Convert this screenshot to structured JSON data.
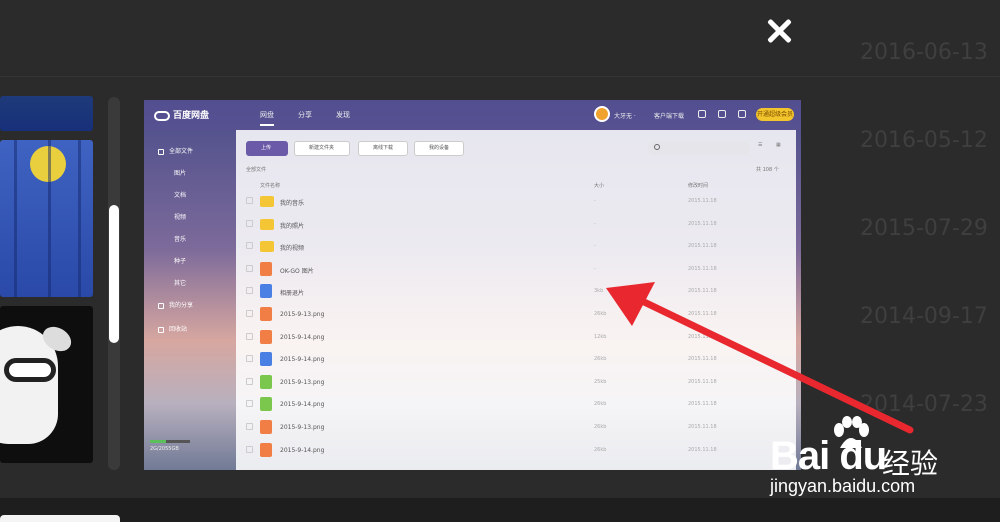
{
  "background_dates": [
    "2016-06-13",
    "2016-05-12",
    "2015-07-29",
    "2014-09-17",
    "2014-07-23"
  ],
  "screenshot": {
    "logo": "百度网盘",
    "nav": [
      "网盘",
      "分享",
      "发现"
    ],
    "username": "大牙无 ·",
    "client_download": "客户端下载",
    "vip": "开通超级会员",
    "sidebar": {
      "all_files": "全部文件",
      "categories": [
        "图片",
        "文档",
        "视频",
        "音乐",
        "种子",
        "其它"
      ],
      "my_share": "我的分享",
      "recycle_bin": "回收站",
      "storage": "2G/2055GB"
    },
    "toolbar": {
      "upload": "上传",
      "new_folder": "新建文件夹",
      "offline_download": "离线下载",
      "my_devices": "我的设备"
    },
    "breadcrumb": "全部文件",
    "item_count": "共 108 个",
    "columns": {
      "name": "文件名称",
      "size": "大小",
      "date": "修改时间"
    },
    "files": [
      {
        "name": "我的音乐",
        "type": "folder",
        "size": "-",
        "date": "2015.11.18"
      },
      {
        "name": "我的照片",
        "type": "folder",
        "size": "-",
        "date": "2015.11.18"
      },
      {
        "name": "我的视频",
        "type": "folder",
        "size": "-",
        "date": "2015.11.18"
      },
      {
        "name": "OK-GO 图片",
        "type": "img",
        "size": "-",
        "date": "2015.11.18"
      },
      {
        "name": "相册退片",
        "type": "doc",
        "size": "3kb",
        "date": "2015.11.18"
      },
      {
        "name": "2015-9-13.png",
        "type": "img",
        "size": "26kb",
        "date": "2015.11.18"
      },
      {
        "name": "2015-9-14.png",
        "type": "img",
        "size": "12kb",
        "date": "2015.11.18"
      },
      {
        "name": "2015-9-14.png",
        "type": "doc",
        "size": "26kb",
        "date": "2015.11.18"
      },
      {
        "name": "2015-9-13.png",
        "type": "xls",
        "size": "25kb",
        "date": "2015.11.18"
      },
      {
        "name": "2015-9-14.png",
        "type": "xls",
        "size": "26kb",
        "date": "2015.11.18"
      },
      {
        "name": "2015-9-13.png",
        "type": "img",
        "size": "26kb",
        "date": "2015.11.18"
      },
      {
        "name": "2015-9-14.png",
        "type": "img",
        "size": "26kb",
        "date": "2015.11.18"
      }
    ]
  },
  "watermark": {
    "brand": "Bai  du",
    "cn": "经验",
    "url": "jingyan.baidu.com"
  },
  "colors": {
    "arrow": "#e8282e",
    "accent": "#6b5aa8",
    "vip": "#f3c52d"
  }
}
